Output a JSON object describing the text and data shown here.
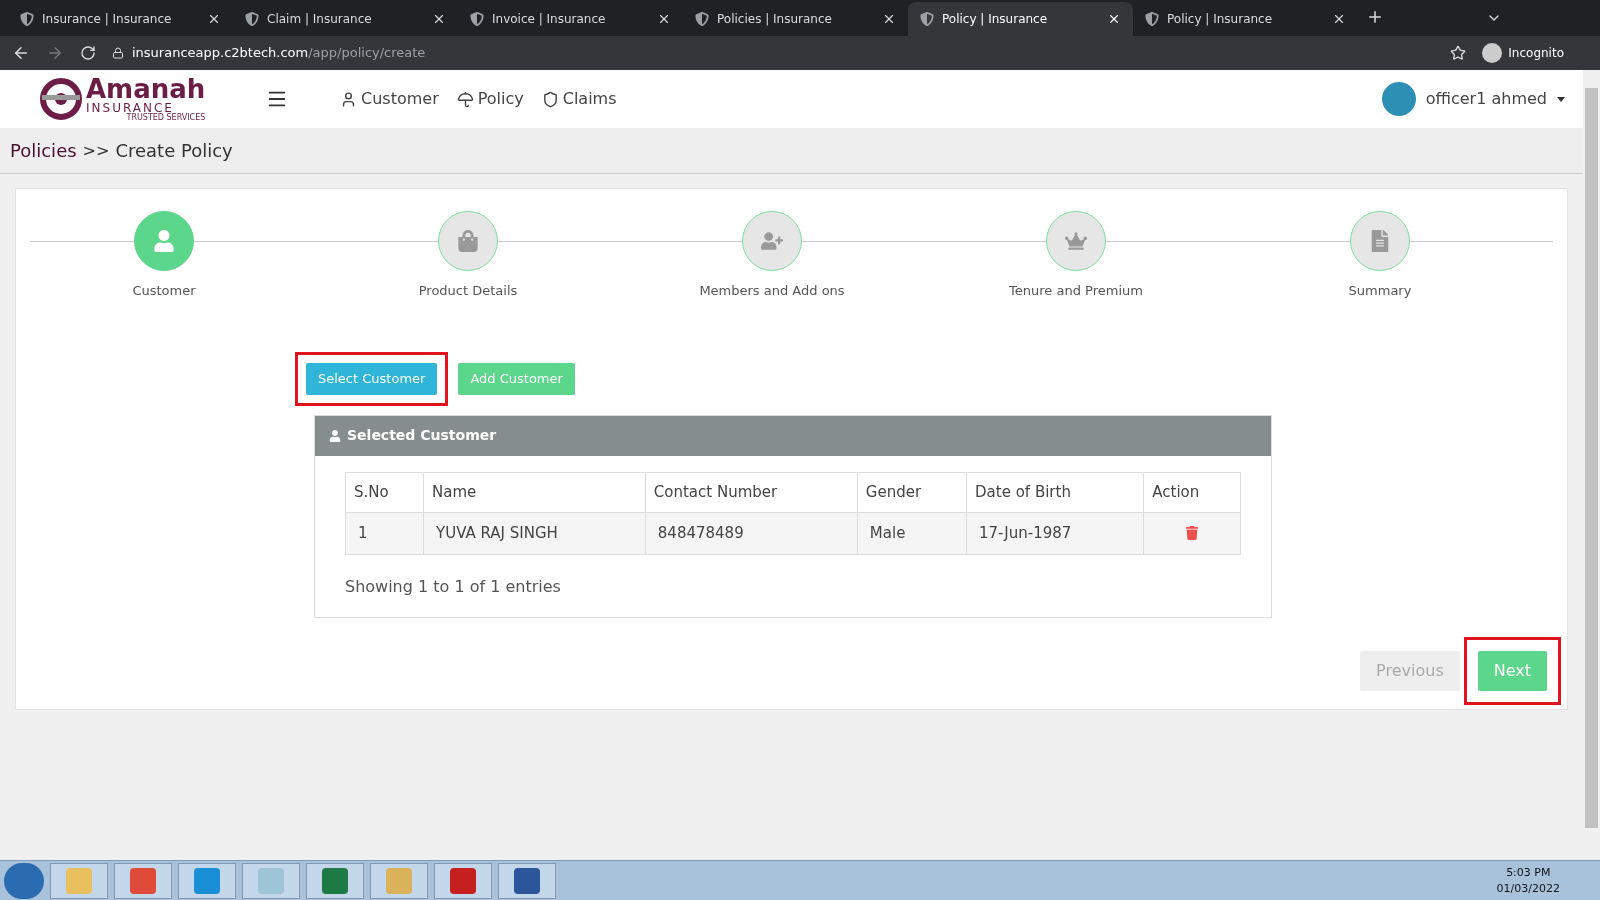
{
  "browser": {
    "tabs": [
      {
        "title": "Insurance | Insurance",
        "selected": false
      },
      {
        "title": "Claim | Insurance",
        "selected": false
      },
      {
        "title": "Invoice | Insurance",
        "selected": false
      },
      {
        "title": "Policies | Insurance",
        "selected": false
      },
      {
        "title": "Policy | Insurance",
        "selected": true
      },
      {
        "title": "Policy | Insurance",
        "selected": false
      }
    ],
    "url_host": "insuranceapp.c2btech.com",
    "url_path": "/app/policy/create",
    "profile": "Incognito"
  },
  "header": {
    "logo_name": "Amanah",
    "logo_sub": "INSURANCE",
    "logo_tag": "TRUSTED SERVICES",
    "nav": [
      "Customer",
      "Policy",
      "Claims"
    ],
    "user": "officer1 ahmed"
  },
  "breadcrumb": {
    "parent": "Policies",
    "separator": ">>",
    "current": "Create Policy"
  },
  "steps": [
    {
      "label": "Customer",
      "selected": true
    },
    {
      "label": "Product Details",
      "selected": false
    },
    {
      "label": "Members and Add ons",
      "selected": false
    },
    {
      "label": "Tenure and Premium",
      "selected": false
    },
    {
      "label": "Summary",
      "selected": false
    }
  ],
  "actions": [
    {
      "label": "Select Customer",
      "highlighted": true,
      "color": "#2fb5d8"
    },
    {
      "label": "Add Customer",
      "highlighted": false,
      "color": "#5bd68a"
    }
  ],
  "panel": {
    "title": "Selected Customer",
    "columns": [
      "S.No",
      "Name",
      "Contact Number",
      "Gender",
      "Date of Birth",
      "Action"
    ],
    "rows": [
      [
        "1",
        "YUVA RAJ SINGH",
        "848478489",
        "Male",
        "17-Jun-1987"
      ]
    ],
    "footer": "Showing 1 to 1 of 1 entries"
  },
  "nav_buttons": [
    {
      "label": "Previous",
      "disabled": true,
      "highlighted": false
    },
    {
      "label": "Next",
      "disabled": false,
      "highlighted": true
    }
  ],
  "taskbar": {
    "time": "5:03 PM",
    "date": "01/03/2022"
  }
}
